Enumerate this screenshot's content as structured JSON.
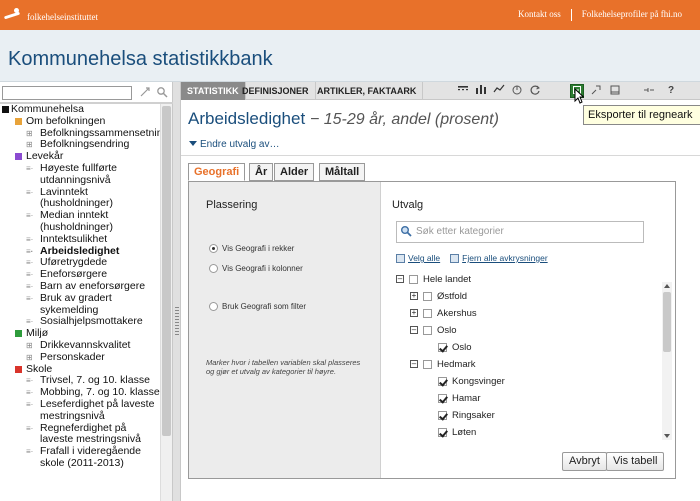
{
  "brand": {
    "name": "folkehelseinstituttet"
  },
  "top_links": [
    "Kontakt oss",
    "Folkehelseprofiler på fhi.no"
  ],
  "site_title": "Kommunehelsa statistikkbank",
  "colors": {
    "brand_orange": "#e8712a",
    "title_blue": "#1a4e7c"
  },
  "sidebar": {
    "tree": [
      {
        "label": "Kommunehelsa",
        "level": 0,
        "box": "#111"
      },
      {
        "label": "Om befolkningen",
        "level": 1,
        "box": "#e8a33a"
      },
      {
        "label": "Befolkningssammensetning",
        "level": 2,
        "plus": true
      },
      {
        "label": "Befolkningsendring",
        "level": 2,
        "plus": true
      },
      {
        "label": "Levekår",
        "level": 1,
        "box": "#8b4bd1"
      },
      {
        "label": "Høyeste fullførte utdanningsnivå",
        "level": 2
      },
      {
        "label": "Lavinntekt (husholdninger)",
        "level": 2
      },
      {
        "label": "Median inntekt (husholdninger)",
        "level": 2
      },
      {
        "label": "Inntektsulikhet",
        "level": 2
      },
      {
        "label": "Arbeidsledighet",
        "level": 2,
        "bold": true
      },
      {
        "label": "Uføretrygdede",
        "level": 2
      },
      {
        "label": "Eneforsørgere",
        "level": 2
      },
      {
        "label": "Barn av eneforsørgere",
        "level": 2
      },
      {
        "label": "Bruk av gradert sykemelding",
        "level": 2
      },
      {
        "label": "Sosialhjelpsmottakere",
        "level": 2
      },
      {
        "label": "Miljø",
        "level": 1,
        "box": "#2e9c3c"
      },
      {
        "label": "Drikkevannskvalitet",
        "level": 2,
        "plus": true
      },
      {
        "label": "Personskader",
        "level": 2,
        "plus": true
      },
      {
        "label": "Skole",
        "level": 1,
        "box": "#d9342b"
      },
      {
        "label": "Trivsel, 7. og 10. klasse",
        "level": 2
      },
      {
        "label": "Mobbing, 7. og 10. klasse",
        "level": 2
      },
      {
        "label": "Leseferdighet på laveste mestringsnivå",
        "level": 2
      },
      {
        "label": "Regneferdighet på laveste mestringsnivå",
        "level": 2
      },
      {
        "label": "Frafall i videregående skole (2011-2013)",
        "level": 2
      }
    ]
  },
  "toolbar": {
    "tabs": [
      "STATISTIKK",
      "DEFINISJONER",
      "ARTIKLER, FAKTAARK"
    ],
    "active_tab": "STATISTIKK",
    "icons": [
      "table-icon",
      "bar-chart-icon",
      "line-chart-icon",
      "pie-chart-icon",
      "refresh-icon",
      "export-icon",
      "settings-icon",
      "print-icon",
      "link-icon",
      "help-icon"
    ],
    "tooltip": "Eksporter til regneark"
  },
  "table": {
    "title": "Arbeidsledighet",
    "subtitle": "− 15-29 år, andel (prosent)",
    "change_selection": "Endre utvalg av…"
  },
  "dialog": {
    "tabs": [
      "Geografi",
      "År",
      "Alder",
      "Måltall"
    ],
    "active_tab": "Geografi",
    "left_heading": "Plassering",
    "radio_rows": "Vis Geografi i rekker",
    "radio_cols": "Vis Geografi i kolonner",
    "radio_filter": "Bruk Geografi som filter",
    "selected_radio": "rows",
    "note": "Marker hvor i tabellen variablen skal plasseres og gjør et utvalg av kategorier til høyre.",
    "right_heading": "Utvalg",
    "search_placeholder": "Søk etter kategorier",
    "select_all": "Velg alle",
    "clear_all": "Fjern alle avkrysninger",
    "categories": [
      {
        "label": "Hele landet",
        "depth": 0,
        "expander": "minus",
        "checked": false
      },
      {
        "label": "Østfold",
        "depth": 1,
        "expander": "plus",
        "checked": false
      },
      {
        "label": "Akershus",
        "depth": 1,
        "expander": "plus",
        "checked": false
      },
      {
        "label": "Oslo",
        "depth": 1,
        "expander": "minus",
        "checked": false
      },
      {
        "label": "Oslo",
        "depth": 2,
        "expander": null,
        "checked": true
      },
      {
        "label": "Hedmark",
        "depth": 1,
        "expander": "minus",
        "checked": false
      },
      {
        "label": "Kongsvinger",
        "depth": 2,
        "expander": null,
        "checked": true
      },
      {
        "label": "Hamar",
        "depth": 2,
        "expander": null,
        "checked": true
      },
      {
        "label": "Ringsaker",
        "depth": 2,
        "expander": null,
        "checked": true
      },
      {
        "label": "Løten",
        "depth": 2,
        "expander": null,
        "checked": true
      }
    ],
    "cancel_label": "Avbryt",
    "show_table_label": "Vis tabell"
  }
}
